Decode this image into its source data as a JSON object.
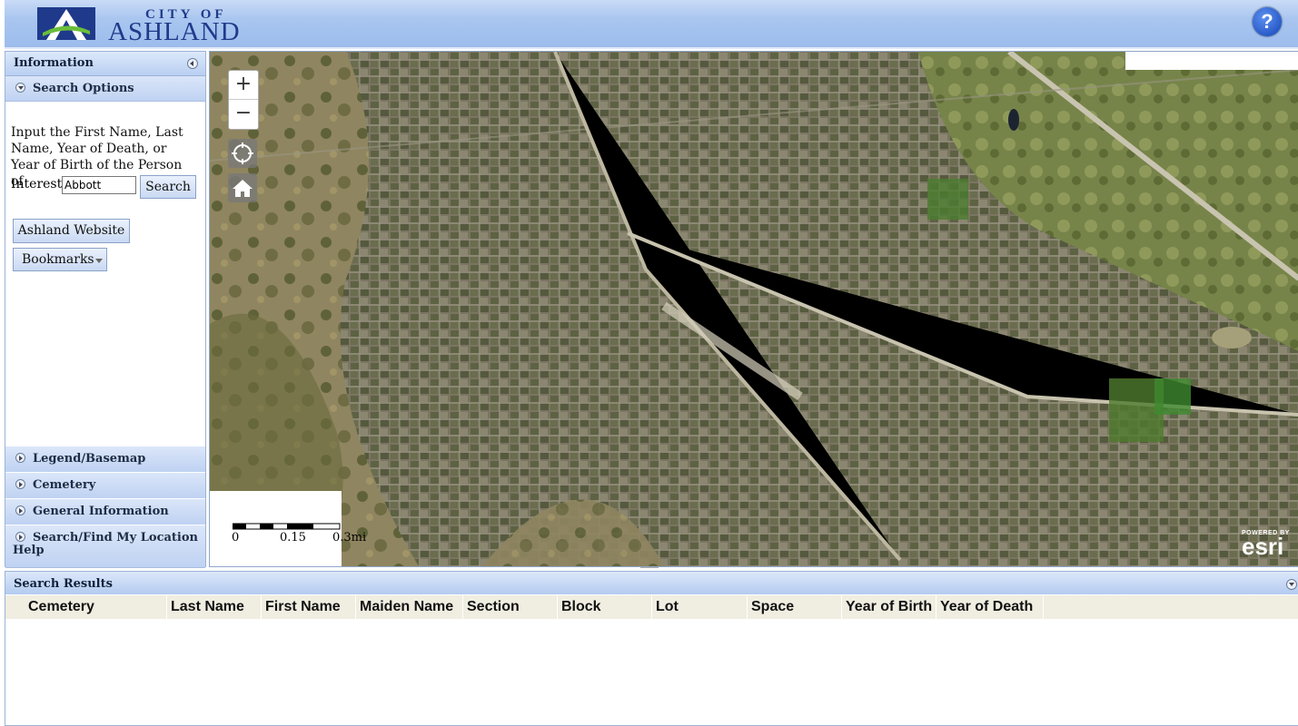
{
  "header": {
    "logo_city": "CITY OF",
    "logo_name": "ASHLAND",
    "help_icon": "help-icon",
    "help_label": "?"
  },
  "colors": {
    "header_blue": "#a9c6f0",
    "logo_blue": "#1f3a8a",
    "logo_green": "#6abf3a",
    "panel_border": "#9cb3d6"
  },
  "left_panel": {
    "title": "Information",
    "search_options": {
      "title": "Search Options",
      "instructions": "Input the First Name, Last Name, Year of Death, or Year of Birth of the Person of",
      "input_label": "Interest:",
      "input_value": "Abbott",
      "search_button": "Search",
      "website_button": "Ashland Website",
      "bookmarks_button": "Bookmarks"
    },
    "accordion": [
      {
        "label": "Legend/Basemap"
      },
      {
        "label": "Cemetery"
      },
      {
        "label": "General Information"
      },
      {
        "label": "Search/Find My Location"
      }
    ],
    "help_label": "Help"
  },
  "map": {
    "zoom_in": "+",
    "zoom_out": "−",
    "locate_icon": "crosshair-icon",
    "home_icon": "home-icon",
    "scale": {
      "labels": [
        "0",
        "0.15",
        "0.3mi"
      ]
    },
    "attribution": {
      "powered_by": "POWERED BY",
      "brand": "esri"
    }
  },
  "results": {
    "title": "Search Results",
    "columns": [
      "Cemetery",
      "Last Name",
      "First Name",
      "Maiden Name",
      "Section",
      "Block",
      "Lot",
      "Space",
      "Year of Birth",
      "Year of Death"
    ],
    "rows": []
  }
}
